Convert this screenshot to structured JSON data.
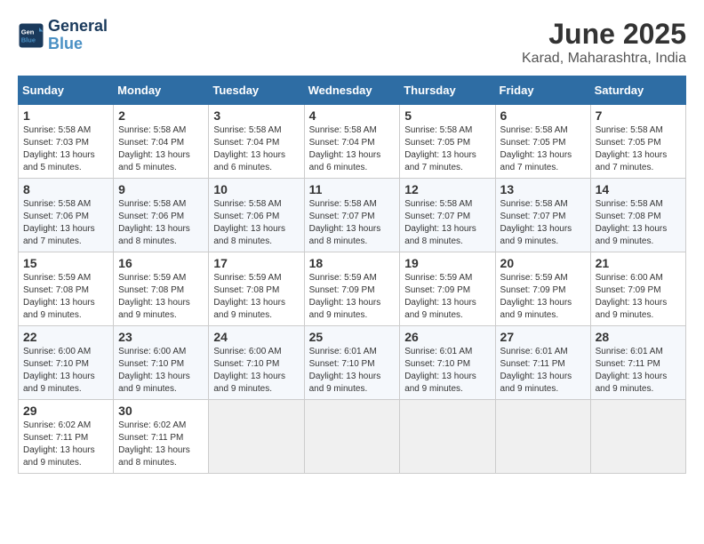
{
  "header": {
    "logo_line1": "General",
    "logo_line2": "Blue",
    "month": "June 2025",
    "location": "Karad, Maharashtra, India"
  },
  "weekdays": [
    "Sunday",
    "Monday",
    "Tuesday",
    "Wednesday",
    "Thursday",
    "Friday",
    "Saturday"
  ],
  "weeks": [
    [
      {
        "day": "1",
        "info": "Sunrise: 5:58 AM\nSunset: 7:03 PM\nDaylight: 13 hours and 5 minutes."
      },
      {
        "day": "2",
        "info": "Sunrise: 5:58 AM\nSunset: 7:04 PM\nDaylight: 13 hours and 5 minutes."
      },
      {
        "day": "3",
        "info": "Sunrise: 5:58 AM\nSunset: 7:04 PM\nDaylight: 13 hours and 6 minutes."
      },
      {
        "day": "4",
        "info": "Sunrise: 5:58 AM\nSunset: 7:04 PM\nDaylight: 13 hours and 6 minutes."
      },
      {
        "day": "5",
        "info": "Sunrise: 5:58 AM\nSunset: 7:05 PM\nDaylight: 13 hours and 7 minutes."
      },
      {
        "day": "6",
        "info": "Sunrise: 5:58 AM\nSunset: 7:05 PM\nDaylight: 13 hours and 7 minutes."
      },
      {
        "day": "7",
        "info": "Sunrise: 5:58 AM\nSunset: 7:05 PM\nDaylight: 13 hours and 7 minutes."
      }
    ],
    [
      {
        "day": "8",
        "info": "Sunrise: 5:58 AM\nSunset: 7:06 PM\nDaylight: 13 hours and 7 minutes."
      },
      {
        "day": "9",
        "info": "Sunrise: 5:58 AM\nSunset: 7:06 PM\nDaylight: 13 hours and 8 minutes."
      },
      {
        "day": "10",
        "info": "Sunrise: 5:58 AM\nSunset: 7:06 PM\nDaylight: 13 hours and 8 minutes."
      },
      {
        "day": "11",
        "info": "Sunrise: 5:58 AM\nSunset: 7:07 PM\nDaylight: 13 hours and 8 minutes."
      },
      {
        "day": "12",
        "info": "Sunrise: 5:58 AM\nSunset: 7:07 PM\nDaylight: 13 hours and 8 minutes."
      },
      {
        "day": "13",
        "info": "Sunrise: 5:58 AM\nSunset: 7:07 PM\nDaylight: 13 hours and 9 minutes."
      },
      {
        "day": "14",
        "info": "Sunrise: 5:58 AM\nSunset: 7:08 PM\nDaylight: 13 hours and 9 minutes."
      }
    ],
    [
      {
        "day": "15",
        "info": "Sunrise: 5:59 AM\nSunset: 7:08 PM\nDaylight: 13 hours and 9 minutes."
      },
      {
        "day": "16",
        "info": "Sunrise: 5:59 AM\nSunset: 7:08 PM\nDaylight: 13 hours and 9 minutes."
      },
      {
        "day": "17",
        "info": "Sunrise: 5:59 AM\nSunset: 7:08 PM\nDaylight: 13 hours and 9 minutes."
      },
      {
        "day": "18",
        "info": "Sunrise: 5:59 AM\nSunset: 7:09 PM\nDaylight: 13 hours and 9 minutes."
      },
      {
        "day": "19",
        "info": "Sunrise: 5:59 AM\nSunset: 7:09 PM\nDaylight: 13 hours and 9 minutes."
      },
      {
        "day": "20",
        "info": "Sunrise: 5:59 AM\nSunset: 7:09 PM\nDaylight: 13 hours and 9 minutes."
      },
      {
        "day": "21",
        "info": "Sunrise: 6:00 AM\nSunset: 7:09 PM\nDaylight: 13 hours and 9 minutes."
      }
    ],
    [
      {
        "day": "22",
        "info": "Sunrise: 6:00 AM\nSunset: 7:10 PM\nDaylight: 13 hours and 9 minutes."
      },
      {
        "day": "23",
        "info": "Sunrise: 6:00 AM\nSunset: 7:10 PM\nDaylight: 13 hours and 9 minutes."
      },
      {
        "day": "24",
        "info": "Sunrise: 6:00 AM\nSunset: 7:10 PM\nDaylight: 13 hours and 9 minutes."
      },
      {
        "day": "25",
        "info": "Sunrise: 6:01 AM\nSunset: 7:10 PM\nDaylight: 13 hours and 9 minutes."
      },
      {
        "day": "26",
        "info": "Sunrise: 6:01 AM\nSunset: 7:10 PM\nDaylight: 13 hours and 9 minutes."
      },
      {
        "day": "27",
        "info": "Sunrise: 6:01 AM\nSunset: 7:11 PM\nDaylight: 13 hours and 9 minutes."
      },
      {
        "day": "28",
        "info": "Sunrise: 6:01 AM\nSunset: 7:11 PM\nDaylight: 13 hours and 9 minutes."
      }
    ],
    [
      {
        "day": "29",
        "info": "Sunrise: 6:02 AM\nSunset: 7:11 PM\nDaylight: 13 hours and 9 minutes."
      },
      {
        "day": "30",
        "info": "Sunrise: 6:02 AM\nSunset: 7:11 PM\nDaylight: 13 hours and 8 minutes."
      },
      {
        "day": "",
        "info": ""
      },
      {
        "day": "",
        "info": ""
      },
      {
        "day": "",
        "info": ""
      },
      {
        "day": "",
        "info": ""
      },
      {
        "day": "",
        "info": ""
      }
    ]
  ]
}
